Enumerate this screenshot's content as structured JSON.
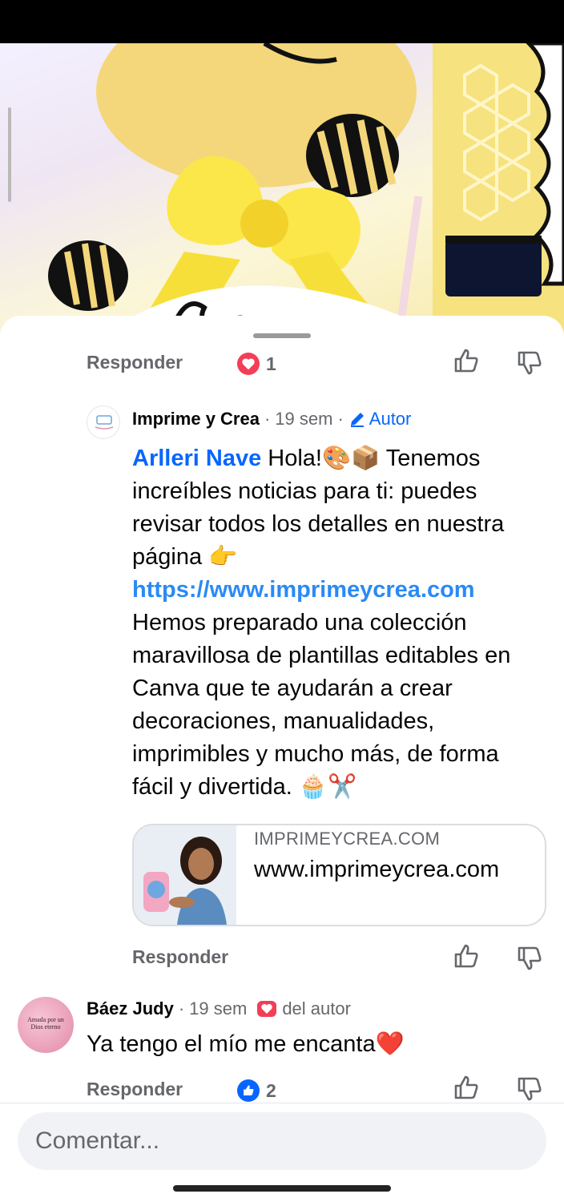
{
  "comment_top": {
    "reply_label": "Responder",
    "reaction_icon": "love-icon",
    "reaction_count": "1"
  },
  "reply_comment": {
    "author": "Imprime y Crea",
    "time": "19 sem",
    "author_badge": "Autor",
    "mention": "Arlleri Nave",
    "text_part1": " Hola!🎨📦 Tenemos increíbles noticias para ti: puedes revisar todos los detalles en nuestra página 👉",
    "link": "https://www.imprimeycrea.com",
    "text_part2": "Hemos preparado una colección maravillosa de plantillas editables en Canva que te ayudarán a crear decoraciones, manualidades, imprimibles y mucho más, de forma fácil y divertida. 🧁✂️",
    "preview_domain": "IMPRIMEYCREA.COM",
    "preview_title": "www.imprimeycrea.com",
    "reply_label": "Responder"
  },
  "comment2": {
    "author": "Báez Judy",
    "time": "19 sem",
    "author_love": "del autor",
    "avatar_text": "Amada por un Dios eterno",
    "text": "Ya tengo el mío me encanta❤️",
    "reply_label": "Responder",
    "reaction_icon": "like-icon",
    "reaction_count": "2"
  },
  "composer": {
    "placeholder": "Comentar..."
  },
  "colors": {
    "accent": "#0866ff",
    "love": "#f33e58",
    "secondary_text": "#65676b"
  }
}
